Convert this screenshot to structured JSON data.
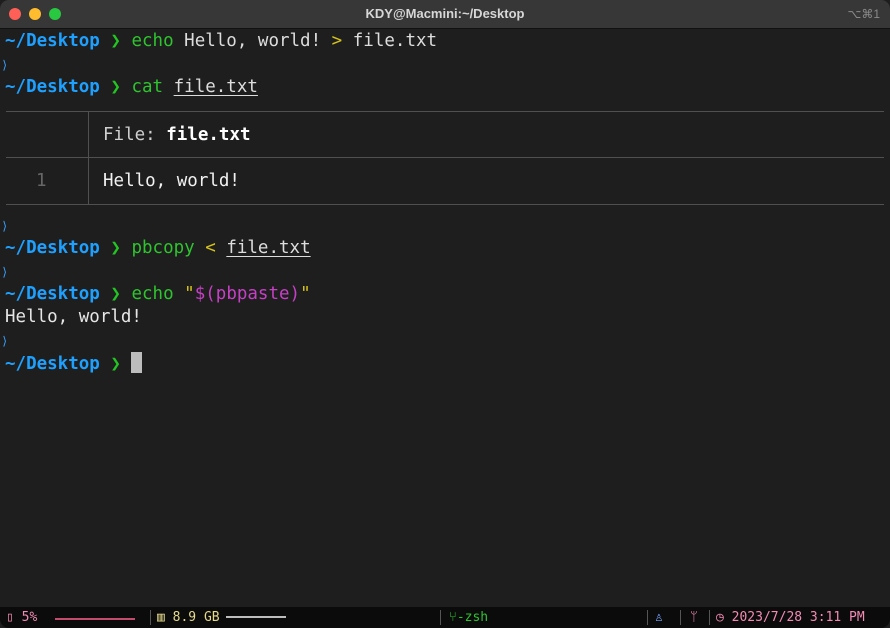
{
  "window": {
    "title": "KDY@Macmini:~/Desktop",
    "shortcut": "⌥⌘1"
  },
  "terminal": {
    "prompt_path": "~/Desktop",
    "prompt_symbol": "❯",
    "row_marker": "⟩",
    "commands": [
      {
        "cmd": "echo",
        "args": " Hello, world! ",
        "op": ">",
        "file": "file.txt"
      },
      {
        "cmd": "cat",
        "file": "file.txt"
      },
      {
        "cmd": "pbcopy",
        "op": "<",
        "file": "file.txt"
      },
      {
        "cmd": "echo",
        "str_open": "\"",
        "sub": "$(pbpaste)",
        "str_close": "\""
      }
    ],
    "bat": {
      "header_label": "File:",
      "header_file": "file.txt",
      "line_number": "1",
      "line_content": "Hello, world!"
    },
    "echo_output": "Hello, world!"
  },
  "statusbar": {
    "cpu": "5%",
    "memory": "8.9 GB",
    "shell": "-zsh",
    "datetime": "2023/7/28 3:11 PM"
  },
  "colors": {
    "background": "#1e1e1e",
    "path": "#1ea0ff",
    "command": "#2ec42e",
    "operator": "#d6c21a",
    "substitution": "#c540c5",
    "status_pink": "#f28ab2"
  }
}
